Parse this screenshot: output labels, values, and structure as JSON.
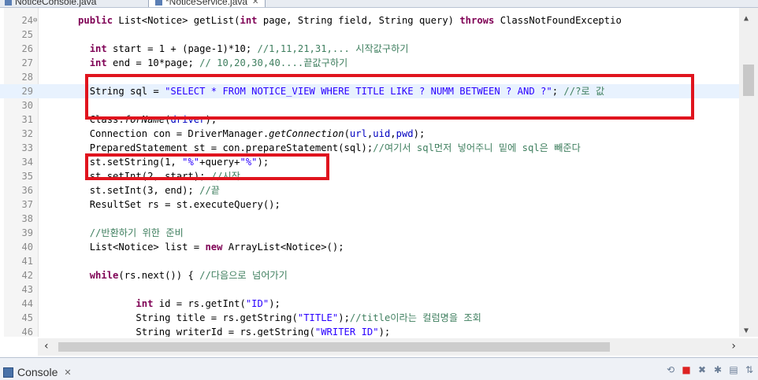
{
  "tabs": [
    {
      "label": "NoticeConsole.java",
      "active": false
    },
    {
      "label": "*NoticeService.java",
      "active": true,
      "close": "✕"
    }
  ],
  "editor": {
    "lines": [
      {
        "num": "24",
        "marker": "⊖",
        "segments": [
          [
            "      ",
            "t"
          ],
          [
            "public",
            "kw"
          ],
          [
            " List<Notice> getList(",
            "t"
          ],
          [
            "int",
            "kw"
          ],
          [
            " page, String field, String query) ",
            "t"
          ],
          [
            "throws",
            "kw"
          ],
          [
            " ClassNotFoundExceptio",
            "t"
          ]
        ]
      },
      {
        "num": "25",
        "segments": []
      },
      {
        "num": "26",
        "segments": [
          [
            "        ",
            "t"
          ],
          [
            "int",
            "kw"
          ],
          [
            " start = 1 + (page-1)*10; ",
            "t"
          ],
          [
            "//1,11,21,31,... 시작값구하기",
            "cm"
          ]
        ]
      },
      {
        "num": "27",
        "segments": [
          [
            "        ",
            "t"
          ],
          [
            "int",
            "kw"
          ],
          [
            " end = 10*page; ",
            "t"
          ],
          [
            "// 10,20,30,40....끝값구하기",
            "cm"
          ]
        ]
      },
      {
        "num": "28",
        "segments": []
      },
      {
        "num": "29",
        "highlight": true,
        "segments": [
          [
            "        String sql = ",
            "t"
          ],
          [
            "\"SELECT * FROM NOTICE_VIEW WHERE TITLE LIKE ? NUMM BETWEEN ? AND ?\"",
            "str"
          ],
          [
            "; ",
            "t"
          ],
          [
            "//?로 값 ",
            "cm"
          ]
        ]
      },
      {
        "num": "30",
        "segments": []
      },
      {
        "num": "31",
        "segments": [
          [
            "        Class.",
            "t"
          ],
          [
            "forName",
            "it"
          ],
          [
            "(",
            "t"
          ],
          [
            "driver",
            "fld"
          ],
          [
            ");",
            "t"
          ]
        ]
      },
      {
        "num": "32",
        "segments": [
          [
            "        Connection con = DriverManager.",
            "t"
          ],
          [
            "getConnection",
            "it"
          ],
          [
            "(",
            "t"
          ],
          [
            "url",
            "fld"
          ],
          [
            ",",
            "t"
          ],
          [
            "uid",
            "fld"
          ],
          [
            ",",
            "t"
          ],
          [
            "pwd",
            "fld"
          ],
          [
            ");",
            "t"
          ]
        ]
      },
      {
        "num": "33",
        "segments": [
          [
            "        PreparedStatement st = con.prepareStatement(sql);",
            "t"
          ],
          [
            "//여기서 sql먼저 넣어주니 밑에 sql은 빼준다",
            "cm"
          ]
        ]
      },
      {
        "num": "34",
        "segments": [
          [
            "        st.setString(1, ",
            "t"
          ],
          [
            "\"%\"",
            "str"
          ],
          [
            "+query+",
            "t"
          ],
          [
            "\"%\"",
            "str"
          ],
          [
            ");",
            "t"
          ]
        ]
      },
      {
        "num": "35",
        "segments": [
          [
            "        st.setInt(2, start); ",
            "t"
          ],
          [
            "//시작",
            "cm"
          ]
        ]
      },
      {
        "num": "36",
        "segments": [
          [
            "        st.setInt(3, end); ",
            "t"
          ],
          [
            "//끝",
            "cm"
          ]
        ]
      },
      {
        "num": "37",
        "segments": [
          [
            "        ResultSet rs = st.executeQuery();",
            "t"
          ]
        ]
      },
      {
        "num": "38",
        "segments": []
      },
      {
        "num": "39",
        "segments": [
          [
            "        ",
            "t"
          ],
          [
            "//반환하기 위한 준비",
            "cm"
          ]
        ]
      },
      {
        "num": "40",
        "segments": [
          [
            "        List<Notice> list = ",
            "t"
          ],
          [
            "new",
            "kw"
          ],
          [
            " ArrayList<Notice>();",
            "t"
          ]
        ]
      },
      {
        "num": "41",
        "segments": []
      },
      {
        "num": "42",
        "segments": [
          [
            "        ",
            "t"
          ],
          [
            "while",
            "kw"
          ],
          [
            "(rs.next()) { ",
            "t"
          ],
          [
            "//다음으로 넘어가기",
            "cm"
          ]
        ]
      },
      {
        "num": "43",
        "segments": []
      },
      {
        "num": "44",
        "segments": [
          [
            "                ",
            "t"
          ],
          [
            "int",
            "kw"
          ],
          [
            " id = rs.getInt(",
            "t"
          ],
          [
            "\"ID\"",
            "str"
          ],
          [
            ");",
            "t"
          ]
        ]
      },
      {
        "num": "45",
        "segments": [
          [
            "                String title = rs.getString(",
            "t"
          ],
          [
            "\"TITLE\"",
            "str"
          ],
          [
            ");",
            "t"
          ],
          [
            "//title이라는 컬럼명을 조회",
            "cm"
          ]
        ]
      },
      {
        "num": "46",
        "segments": [
          [
            "                String writerId = rs.getString(",
            "t"
          ],
          [
            "\"WRITER_ID\"",
            "str"
          ],
          [
            ");",
            "t"
          ]
        ]
      }
    ]
  },
  "scroll": {
    "up": "▲",
    "down": "▼",
    "left": "‹",
    "right": "›"
  },
  "console": {
    "label": "Console",
    "close": "✕",
    "tools": [
      "⟲",
      "■",
      "✖",
      "✱",
      "▤",
      "⇅"
    ]
  }
}
